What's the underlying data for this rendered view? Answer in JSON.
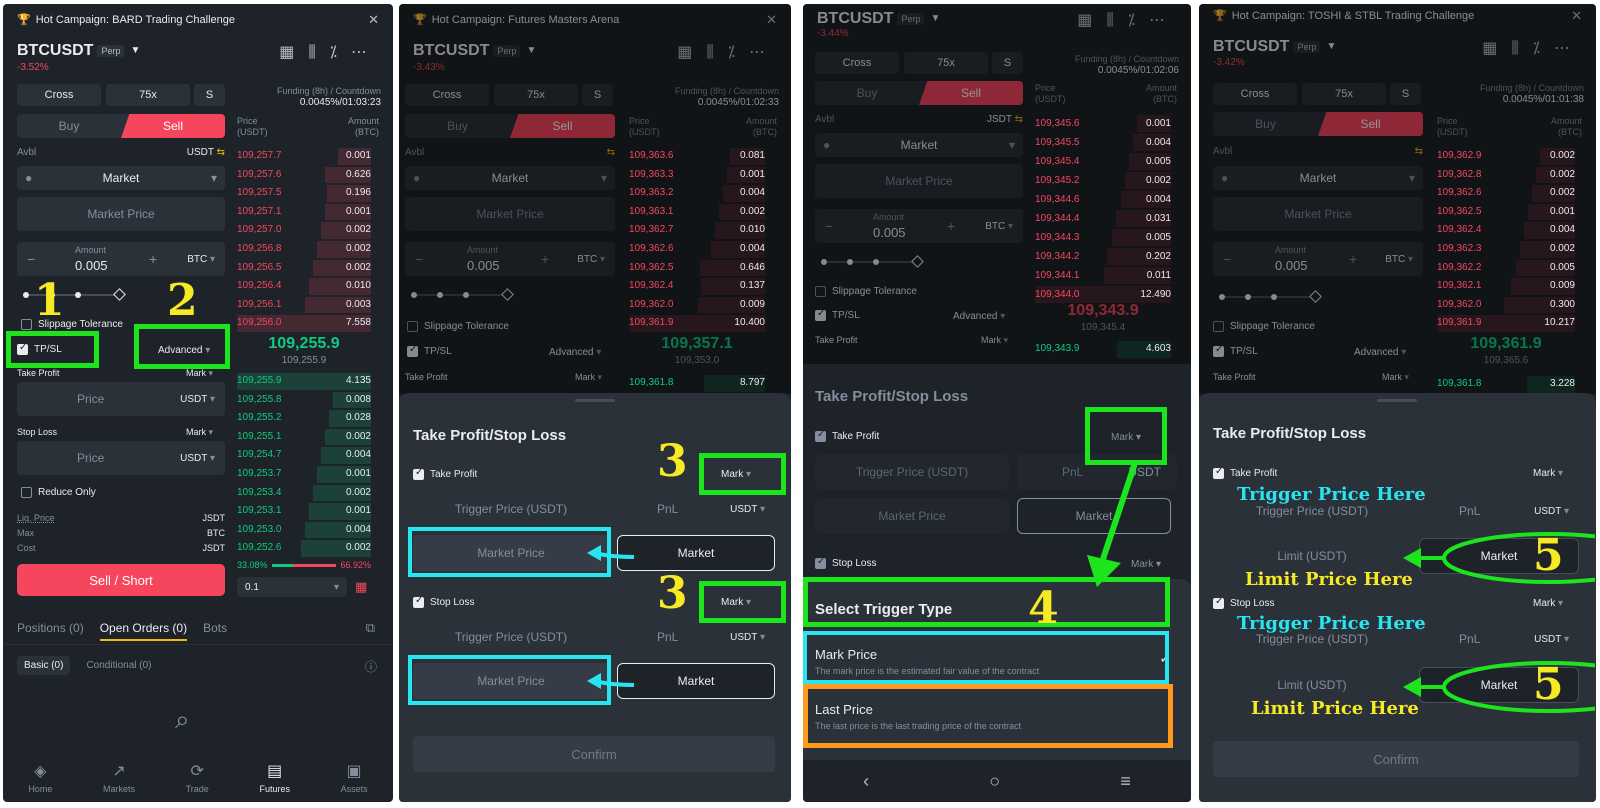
{
  "common": {
    "symbol": "BTCUSDT",
    "perp": "Perp",
    "cross": "Cross",
    "leverage": "75x",
    "size_mode": "S",
    "funding_label": "Funding (8h) / Countdown",
    "buy": "Buy",
    "sell": "Sell",
    "avbl": "Avbl",
    "usdt": "USDT",
    "order_type": "Market",
    "market_price": "Market Price",
    "amount_label": "Amount",
    "amount": "0.005",
    "btc": "BTC",
    "slippage": "Slippage Tolerance",
    "tpsl": "TP/SL",
    "advanced": "Advanced",
    "take_profit": "Take Profit",
    "stop_loss": "Stop Loss",
    "mark": "Mark",
    "price": "Price",
    "price_usdt_1": "Price",
    "price_usdt_2": "(USDT)",
    "amount_btc_1": "Amount",
    "amount_btc_2": "(BTC)",
    "sheet_title": "Take Profit/Stop Loss",
    "trigger_price": "Trigger Price (USDT)",
    "pnl": "PnL",
    "confirm": "Confirm",
    "limit_usdt": "Limit (USDT)"
  },
  "panel1": {
    "campaign": "Hot Campaign: BARD Trading Challenge",
    "change": "-3.52%",
    "funding": "0.0045%/01:03:23",
    "asks": [
      [
        "109,257.7",
        "0.001"
      ],
      [
        "109,257.6",
        "0.626"
      ],
      [
        "109,257.5",
        "0.196"
      ],
      [
        "109,257.1",
        "0.001"
      ],
      [
        "109,257.0",
        "0.002"
      ],
      [
        "109,256.8",
        "0.002"
      ],
      [
        "109,256.5",
        "0.002"
      ],
      [
        "109,256.4",
        "0.010"
      ],
      [
        "109,256.1",
        "0.003"
      ],
      [
        "109,256.0",
        "7.558"
      ]
    ],
    "mid": "109,255.9",
    "mark_price": "109,255.9",
    "bids": [
      [
        "109,255.9",
        "4.135"
      ],
      [
        "109,255.8",
        "0.008"
      ],
      [
        "109,255.2",
        "0.028"
      ],
      [
        "109,255.1",
        "0.002"
      ],
      [
        "109,254.7",
        "0.004"
      ],
      [
        "109,253.7",
        "0.001"
      ],
      [
        "109,253.4",
        "0.002"
      ],
      [
        "109,253.1",
        "0.001"
      ],
      [
        "109,253.0",
        "0.004"
      ],
      [
        "109,252.6",
        "0.002"
      ]
    ],
    "reduce_only": "Reduce Only",
    "liq_price": "Liq. Price",
    "max": "Max",
    "cost": "Cost",
    "jsdt": "JSDT",
    "btc_short": "BTC",
    "sell_short": "Sell / Short",
    "ratio_buy": "33.08%",
    "ratio_sell": "66.92%",
    "step": "0.1",
    "tabs": [
      "Positions (0)",
      "Open Orders (0)",
      "Bots"
    ],
    "subtabs": [
      "Basic (0)",
      "Conditional (0)"
    ],
    "nav": [
      {
        "label": "Home",
        "icon": "◈"
      },
      {
        "label": "Markets",
        "icon": "↗"
      },
      {
        "label": "Trade",
        "icon": "⟳"
      },
      {
        "label": "Futures",
        "icon": "▤"
      },
      {
        "label": "Assets",
        "icon": "▣"
      }
    ]
  },
  "panel2": {
    "campaign": "Hot Campaign: Futures Masters Arena",
    "change": "-3.43%",
    "funding": "0.0045%/01:02:33",
    "asks": [
      [
        "109,363.6",
        "0.081"
      ],
      [
        "109,363.3",
        "0.001"
      ],
      [
        "109,363.2",
        "0.004"
      ],
      [
        "109,363.1",
        "0.002"
      ],
      [
        "109,362.7",
        "0.010"
      ],
      [
        "109,362.6",
        "0.004"
      ],
      [
        "109,362.5",
        "0.646"
      ],
      [
        "109,362.4",
        "0.137"
      ],
      [
        "109,362.0",
        "0.009"
      ],
      [
        "109,361.9",
        "10.400"
      ]
    ],
    "mid": "109,357.1",
    "mark_price": "109,353.0",
    "bid_row": [
      "109,361.8",
      "8.797"
    ],
    "market": "Market"
  },
  "panel3": {
    "change": "-3.44%",
    "funding": "0.0045%/01:02:06",
    "jsdt": "JSDT",
    "asks": [
      [
        "109,345.6",
        "0.001"
      ],
      [
        "109,345.5",
        "0.004"
      ],
      [
        "109,345.4",
        "0.005"
      ],
      [
        "109,345.2",
        "0.002"
      ],
      [
        "109,344.6",
        "0.004"
      ],
      [
        "109,344.4",
        "0.031"
      ],
      [
        "109,344.3",
        "0.005"
      ],
      [
        "109,344.2",
        "0.202"
      ],
      [
        "109,344.1",
        "0.011"
      ],
      [
        "109,344.0",
        "12.490"
      ]
    ],
    "mid": "109,343.9",
    "mark_price": "109,345.4",
    "bid_row": [
      "109,343.9",
      "4.603"
    ],
    "market": "Market",
    "select_title": "Select Trigger Type",
    "mark_price_title": "Mark Price",
    "mark_price_desc": "The mark price is the estimated fair value of the contract",
    "last_price_title": "Last Price",
    "last_price_desc": "The last price is the last trading price of the contract",
    "sys_nav": [
      "‹",
      "○",
      "≡"
    ]
  },
  "panel4": {
    "campaign": "Hot Campaign: TOSHI & STBL Trading Challenge",
    "change": "-3.42%",
    "funding": "0.0045%/01:01:38",
    "asks": [
      [
        "109,362.9",
        "0.002"
      ],
      [
        "109,362.8",
        "0.002"
      ],
      [
        "109,362.6",
        "0.002"
      ],
      [
        "109,362.5",
        "0.001"
      ],
      [
        "109,362.4",
        "0.004"
      ],
      [
        "109,362.3",
        "0.002"
      ],
      [
        "109,362.2",
        "0.005"
      ],
      [
        "109,362.1",
        "0.009"
      ],
      [
        "109,362.0",
        "0.300"
      ],
      [
        "109,361.9",
        "10.217"
      ]
    ],
    "mid": "109,361.9",
    "mark_price": "109,365.6",
    "bid_row": [
      "109,361.8",
      "3.228"
    ],
    "market": "Market"
  },
  "annotations": {
    "n1": "1",
    "n2": "2",
    "n3": "3",
    "n4": "4",
    "n5": "5",
    "trigger_here": "Trigger Price Here",
    "limit_here": "Limit Price Here"
  },
  "colors": {
    "bg": "#1e2329",
    "sell": "#f6465d",
    "buy": "#0ecb81",
    "highlight_green": "#1de51d",
    "highlight_cyan": "#27e6f2",
    "highlight_orange": "#ff9a1a",
    "number_yellow": "#f6ea24"
  }
}
